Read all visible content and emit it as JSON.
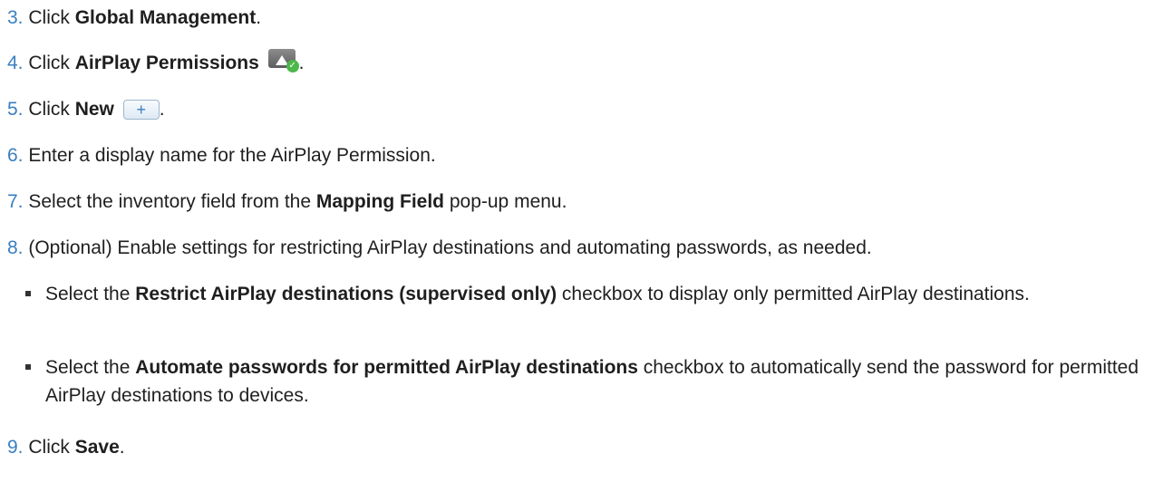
{
  "steps": [
    {
      "num": "3.",
      "pre": "Click ",
      "bold": "Global Management",
      "post": "."
    },
    {
      "num": "4.",
      "pre": "Click ",
      "bold": "AirPlay Permissions",
      "post": ".",
      "icon": "airplay-permissions-icon"
    },
    {
      "num": "5.",
      "pre": "Click ",
      "bold": "New",
      "post": ".",
      "icon": "plus-icon",
      "icon_glyph": "+"
    },
    {
      "num": "6.",
      "pre": "Enter a display name for the AirPlay Permission.",
      "bold": "",
      "post": ""
    },
    {
      "num": "7.",
      "pre": "Select the inventory field from the ",
      "bold": "Mapping Field",
      "post": " pop-up menu."
    },
    {
      "num": "8.",
      "pre": "(Optional) Enable settings for restricting AirPlay destinations and automating passwords, as needed.",
      "bold": "",
      "post": ""
    },
    {
      "num": "9.",
      "pre": "Click ",
      "bold": "Save",
      "post": "."
    }
  ],
  "substeps": [
    {
      "pre": "Select the ",
      "bold": "Restrict AirPlay destinations (supervised only)",
      "post": " checkbox to display only permitted AirPlay destinations."
    },
    {
      "pre": "Select the ",
      "bold": "Automate passwords for permitted AirPlay destinations",
      "post": " checkbox to automatically send the password for permitted AirPlay destinations to devices."
    }
  ],
  "colors": {
    "step_number": "#3a7fc1",
    "text": "#1f1f1f",
    "icon_check": "#4cb84a"
  }
}
